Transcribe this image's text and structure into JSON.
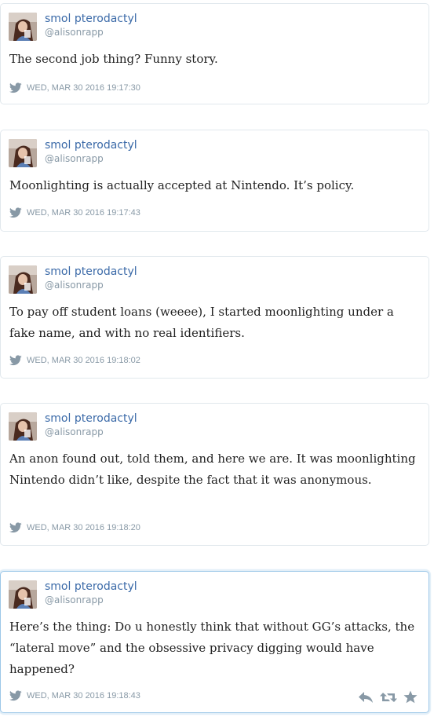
{
  "colors": {
    "name": "#3b6aa8",
    "handle": "#8899a6",
    "text": "#222222",
    "icon": "#8899a6",
    "border": "#e1e8ed",
    "active_border": "#9cc7e8"
  },
  "tweets": [
    {
      "name": "smol pterodactyl",
      "handle": "@alisonrapp",
      "text": "The second job thing? Funny story.",
      "date": "WED, MAR 30 2016 19:17:30"
    },
    {
      "name": "smol pterodactyl",
      "handle": "@alisonrapp",
      "text": "Moonlighting is actually accepted at Nintendo. It’s policy.",
      "date": "WED, MAR 30 2016 19:17:43"
    },
    {
      "name": "smol pterodactyl",
      "handle": "@alisonrapp",
      "text": "To pay off student loans (weeee), I started moonlighting under a fake name, and with no real identifiers.",
      "date": "WED, MAR 30 2016 19:18:02"
    },
    {
      "name": "smol pterodactyl",
      "handle": "@alisonrapp",
      "text": "An anon found out, told them, and here we are. It was moonlighting Nintendo didn’t like, despite the fact that it was anonymous.",
      "date": "WED, MAR 30 2016 19:18:20"
    },
    {
      "name": "smol pterodactyl",
      "handle": "@alisonrapp",
      "text": "Here’s the thing: Do u honestly think that without GG’s attacks, the “lateral move” and the obsessive privacy digging would have happened?",
      "date": "WED, MAR 30 2016 19:18:43"
    }
  ],
  "actions": {
    "reply_icon": "reply-icon",
    "retweet_icon": "retweet-icon",
    "favorite_icon": "star-icon"
  }
}
